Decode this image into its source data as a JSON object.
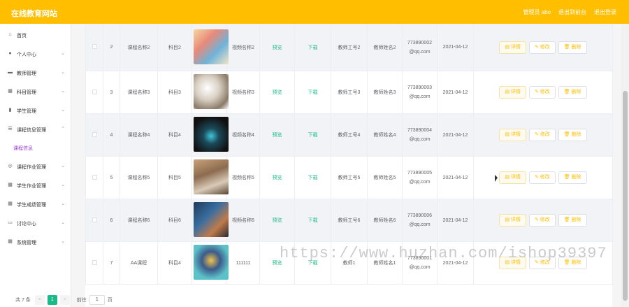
{
  "header": {
    "title": "在线教育网站",
    "user": "管理员 abo",
    "back_label": "退出到前台",
    "logout_label": "退出登录"
  },
  "sidebar": {
    "items": [
      {
        "label": "首页",
        "icon": "home-icon"
      },
      {
        "label": "个人中心",
        "icon": "user-icon"
      },
      {
        "label": "教师管理",
        "icon": "card-icon"
      },
      {
        "label": "科目管理",
        "icon": "grid-icon"
      },
      {
        "label": "学生管理",
        "icon": "chart-icon"
      },
      {
        "label": "课程信息管理",
        "icon": "list-icon"
      },
      {
        "label": "课程作业管理",
        "icon": "target-icon"
      },
      {
        "label": "学生作业管理",
        "icon": "grid-icon"
      },
      {
        "label": "学生成绩管理",
        "icon": "grid-icon"
      },
      {
        "label": "讨论中心",
        "icon": "monitor-icon"
      },
      {
        "label": "系统管理",
        "icon": "grid-icon"
      }
    ],
    "sub_item": "课程信息"
  },
  "table": {
    "rows": [
      {
        "index": "2",
        "course": "课程名称2",
        "subject": "科目2",
        "video": "视频名称2",
        "preview": "预览",
        "download": "下载",
        "teacher_id": "教师工号2",
        "teacher_name": "教师姓名2",
        "email1": "773890002",
        "email2": "@qq.com",
        "date": "2021-04-12"
      },
      {
        "index": "3",
        "course": "课程名称3",
        "subject": "科目3",
        "video": "视频名称3",
        "preview": "预览",
        "download": "下载",
        "teacher_id": "教师工号3",
        "teacher_name": "教师姓名3",
        "email1": "773890003",
        "email2": "@qq.com",
        "date": "2021-04-12"
      },
      {
        "index": "4",
        "course": "课程名称4",
        "subject": "科目4",
        "video": "视频名称4",
        "preview": "预览",
        "download": "下载",
        "teacher_id": "教师工号4",
        "teacher_name": "教师姓名4",
        "email1": "773890004",
        "email2": "@qq.com",
        "date": "2021-04-12"
      },
      {
        "index": "5",
        "course": "课程名称5",
        "subject": "科目5",
        "video": "视频名称5",
        "preview": "预览",
        "download": "下载",
        "teacher_id": "教师工号5",
        "teacher_name": "教师姓名5",
        "email1": "773890005",
        "email2": "@qq.com",
        "date": "2021-04-12"
      },
      {
        "index": "6",
        "course": "课程名称6",
        "subject": "科目6",
        "video": "视频名称6",
        "preview": "预览",
        "download": "下载",
        "teacher_id": "教师工号6",
        "teacher_name": "教师姓名6",
        "email1": "773890006",
        "email2": "@qq.com",
        "date": "2021-04-12"
      },
      {
        "index": "7",
        "course": "AA课程",
        "subject": "科目4",
        "video": "111111",
        "preview": "预览",
        "download": "下载",
        "teacher_id": "教师1",
        "teacher_name": "教师姓名1",
        "email1": "773890001",
        "email2": "@qq.com",
        "date": "2021-04-12"
      }
    ],
    "actions": {
      "detail": "详情",
      "edit": "修改",
      "delete": "删除"
    }
  },
  "pager": {
    "total": "共 7 条",
    "prev": "<",
    "current": "1",
    "next": ">",
    "goto_label": "前往",
    "goto_value": "1",
    "page_unit": "页"
  },
  "watermark": "https://www.huzhan.com/ishop39397",
  "colors": {
    "accent": "#ffbe00",
    "green": "#19b98a",
    "purple": "#9b3ad3"
  }
}
